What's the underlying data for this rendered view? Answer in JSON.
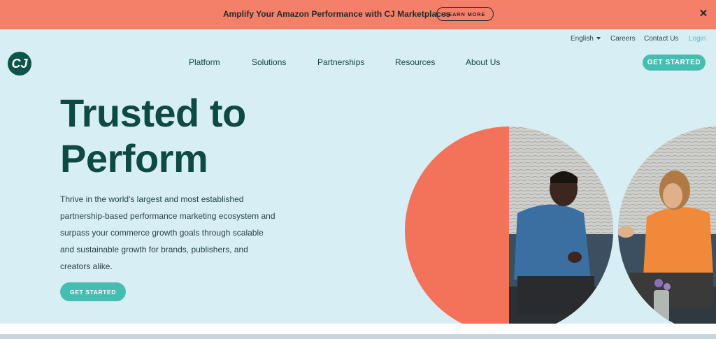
{
  "banner": {
    "text": "Amplify Your Amazon Performance with CJ Marketplaces",
    "button": "LEARN MORE",
    "close_glyph": "✕",
    "close_icon": "close-icon"
  },
  "utility_nav": {
    "language": "English",
    "careers": "Careers",
    "contact": "Contact Us",
    "login": "Login"
  },
  "logo": {
    "text": "CJ",
    "icon": "cj-logo"
  },
  "nav": {
    "items": [
      {
        "label": "Platform"
      },
      {
        "label": "Solutions"
      },
      {
        "label": "Partnerships"
      },
      {
        "label": "Resources"
      },
      {
        "label": "About Us"
      }
    ],
    "cta": "GET STARTED"
  },
  "hero": {
    "title_line1": "Trusted to",
    "title_line2": "Perform",
    "description": "Thrive in the world's largest and most established partnership-based performance marketing ecosystem and surpass your commerce growth goals through scalable and sustainable growth for brands, publishers, and creators alike.",
    "cta": "GET STARTED"
  },
  "colors": {
    "banner": "#f4806a",
    "hero_bg": "#d8eef5",
    "heading": "#0d4a43",
    "accent": "#46bdb1",
    "coral": "#f2735a"
  }
}
